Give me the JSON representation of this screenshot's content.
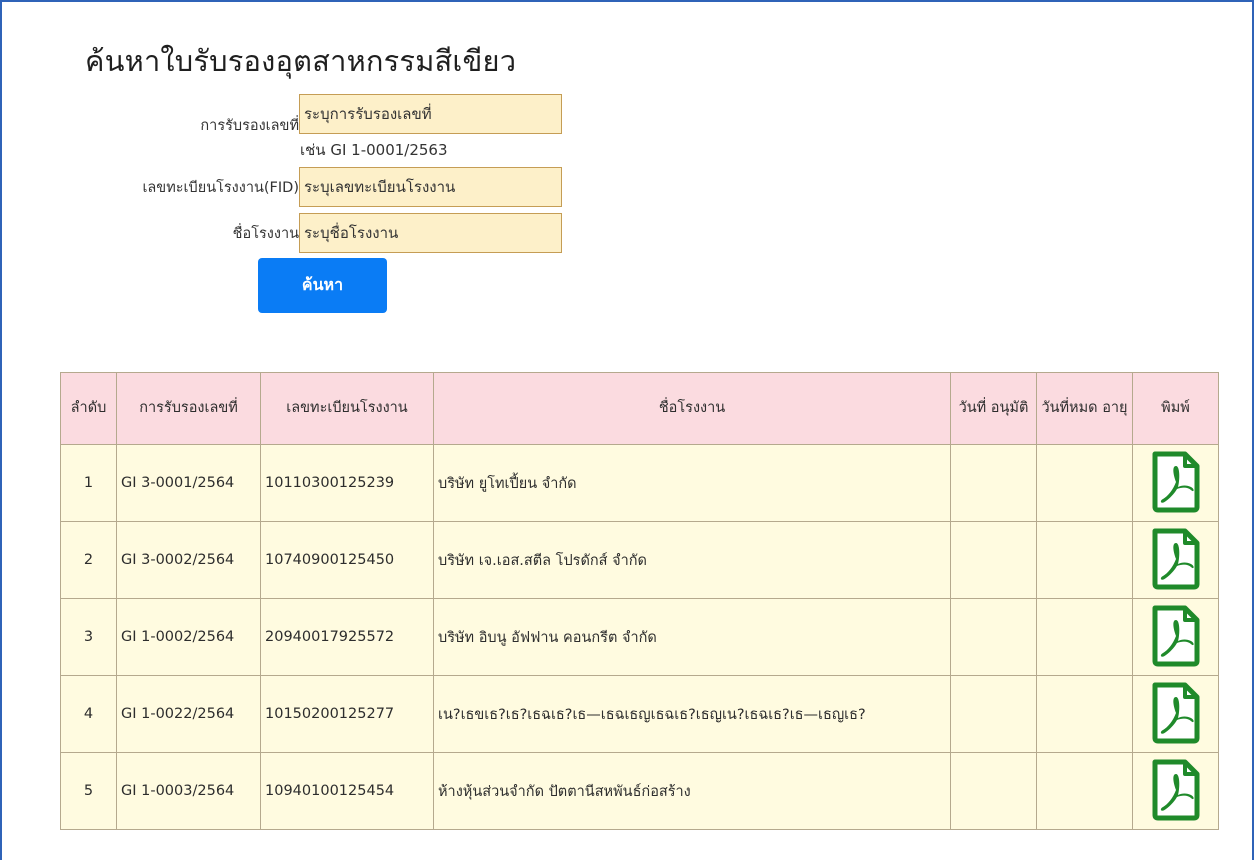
{
  "page": {
    "title": "ค้นหาใบรับรองอุตสาหกรรมสีเขียว"
  },
  "form": {
    "cert_label": "การรับรองเลขที่",
    "cert_placeholder": "ระบุการรับรองเลขที่",
    "cert_hint": "เช่น GI 1-0001/2563",
    "fid_label": "เลขทะเบียนโรงงาน(FID)",
    "fid_placeholder": "ระบุเลขทะเบียนโรงงาน",
    "name_label": "ชื่อโรงงาน",
    "name_placeholder": "ระบุชื่อโรงงาน",
    "search_label": "ค้นหา"
  },
  "table": {
    "headers": {
      "seq": "ลำดับ",
      "cert": "การรับรองเลขที่",
      "fid": "เลขทะเบียนโรงงาน",
      "name": "ชื่อโรงงาน",
      "approved": "วันที่ อนุมัติ",
      "expired": "วันที่หมด อายุ",
      "print": "พิมพ์"
    },
    "rows": [
      {
        "seq": "1",
        "cert": "GI 3-0001/2564",
        "fid": "10110300125239",
        "name": "บริษัท ยูโทเปี้ยน จำกัด",
        "approved": "",
        "expired": "",
        "print_icon": "pdf-icon"
      },
      {
        "seq": "2",
        "cert": "GI 3-0002/2564",
        "fid": "10740900125450",
        "name": "บริษัท เจ.เอส.สตีล โปรดักส์ จำกัด",
        "approved": "",
        "expired": "",
        "print_icon": "pdf-icon"
      },
      {
        "seq": "3",
        "cert": "GI 1-0002/2564",
        "fid": "20940017925572",
        "name": "บริษัท อิบนู อัฟฟาน คอนกรีต จำกัด",
        "approved": "",
        "expired": "",
        "print_icon": "pdf-icon"
      },
      {
        "seq": "4",
        "cert": "GI 1-0022/2564",
        "fid": "10150200125277",
        "name": "เน?เธขเธ?เธ?เธฉเธ?เธ—เธฉเธญเธฉเธ?เธญเน?เธฉเธ?เธ—เธญเธ?",
        "approved": "",
        "expired": "",
        "print_icon": "pdf-icon"
      },
      {
        "seq": "5",
        "cert": "GI 1-0003/2564",
        "fid": "10940100125454",
        "name": "ห้างหุ้นส่วนจำกัด ปัตตานีสหพันธ์ก่อสร้าง",
        "approved": "",
        "expired": "",
        "print_icon": "pdf-icon"
      }
    ]
  },
  "colors": {
    "accent": "#0a7cf5",
    "header_bg": "#fbdbe0",
    "row_bg": "#fffbe0",
    "input_bg": "#fdf0c9",
    "pdf_icon": "#1f8a2a"
  }
}
